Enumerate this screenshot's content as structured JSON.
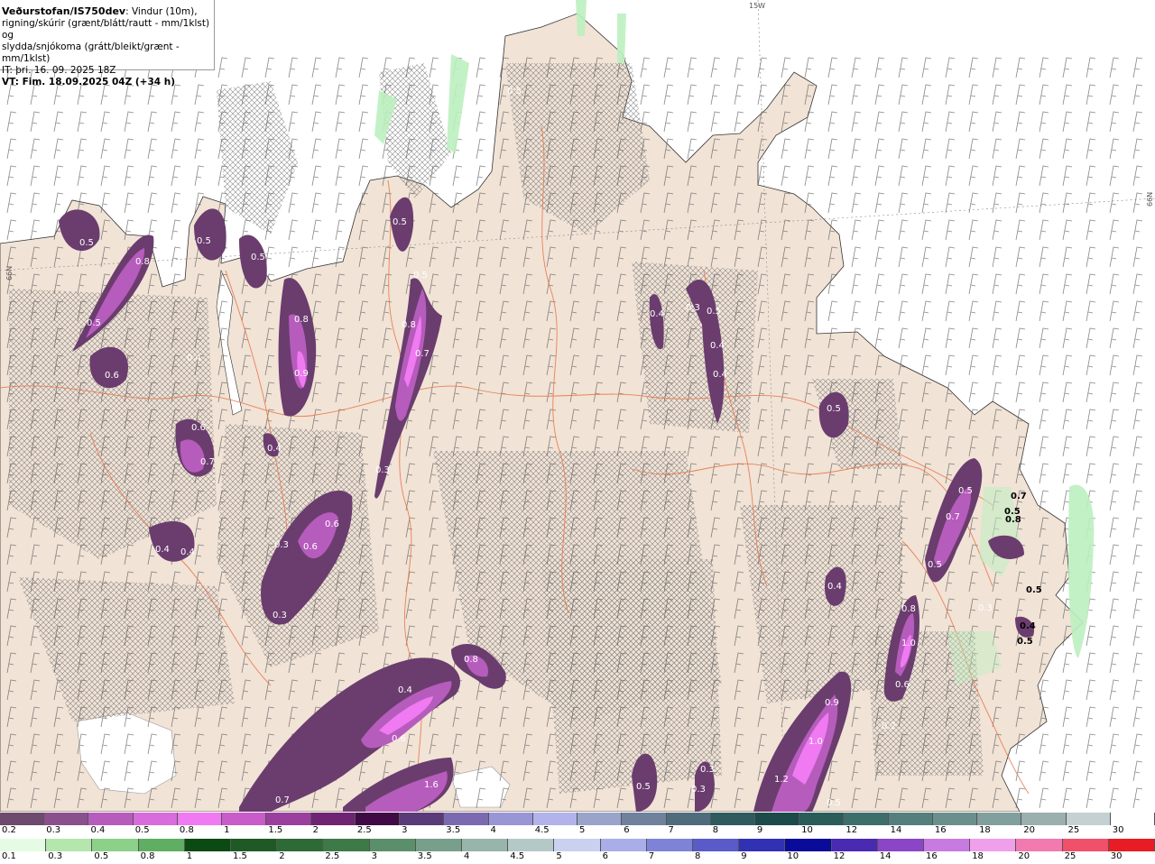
{
  "title": {
    "source": "Veðurstofan/IS750dev",
    "description_line1": ": Vindur (10m),",
    "description_line2": "rigning/skúrir (grænt/blátt/rautt - mm/1klst) og",
    "description_line3": "slydda/snjókoma (grátt/bleikt/grænt - mm/1klst)",
    "issue_time": "IT: þri. 16. 09. 2025 18Z",
    "valid_time": "VT: Fim. 18.09.2025 04Z (+34 h)"
  },
  "grid_labels": {
    "top_meridian": "15W",
    "right_parallel": "66N",
    "left_parallel": "66N"
  },
  "colors": {
    "sea": "#ffffff",
    "land": "#f1e3d6",
    "roads": "#e8774a",
    "snow_dark": "#6a3d6e",
    "snow_mid": "#a64fb2",
    "snow_light": "#e07ee6",
    "rain_green": "#bdf0c0"
  },
  "snow_legend": {
    "labels": [
      "0.2",
      "0.3",
      "0.4",
      "0.5",
      "0.8",
      "1",
      "1.5",
      "2",
      "2.5",
      "3",
      "3.5",
      "4",
      "4.5",
      "5",
      "6",
      "7",
      "8",
      "9",
      "10",
      "12",
      "14",
      "16",
      "18",
      "20",
      "25",
      "30"
    ],
    "colors": [
      "#6d4a6e",
      "#8a4f8c",
      "#b65cbc",
      "#d96cdc",
      "#f07af2",
      "#c85cc9",
      "#9b3f9e",
      "#6f2373",
      "#3f0a45",
      "#5a3a78",
      "#7b6ab0",
      "#9a96d6",
      "#b2b3ea",
      "#9aa3c9",
      "#6f819d",
      "#4f6c7c",
      "#2f5a5e",
      "#1d4a4a",
      "#2a5c5a",
      "#3e6e6c",
      "#547f7c",
      "#6a8f8c",
      "#819f9d",
      "#9aafae",
      "#c5d0d2",
      "#ffffff"
    ]
  },
  "rain_legend": {
    "labels": [
      "0.1",
      "0.3",
      "0.5",
      "0.8",
      "1",
      "1.5",
      "2",
      "2.5",
      "3",
      "3.5",
      "4",
      "4.5",
      "5",
      "6",
      "7",
      "8",
      "9",
      "10",
      "12",
      "14",
      "16",
      "18",
      "20",
      "25",
      "30"
    ],
    "colors": [
      "#e6fbe4",
      "#b4e6ae",
      "#8cd08a",
      "#5fae63",
      "#0b4a12",
      "#1f5a26",
      "#2e6a35",
      "#3d7a48",
      "#5b8f6c",
      "#789f8c",
      "#97b5ab",
      "#b4c8c8",
      "#c9d1f0",
      "#a9aee8",
      "#7f83d8",
      "#5a5ac8",
      "#3131b4",
      "#0b0b9a",
      "#4a2ab0",
      "#8a46c6",
      "#c77ae0",
      "#f0a0ea",
      "#f27ab0",
      "#f0506a",
      "#e81c24"
    ]
  },
  "map_labels": [
    {
      "text": "0.5"
    },
    {
      "text": "0.8"
    },
    {
      "text": "0.5"
    },
    {
      "text": "0.6"
    },
    {
      "text": "0.4"
    },
    {
      "text": "0.6"
    },
    {
      "text": "0.7"
    },
    {
      "text": "0.4"
    },
    {
      "text": "0.4"
    },
    {
      "text": "0.5"
    },
    {
      "text": "0.5"
    },
    {
      "text": "0.8"
    },
    {
      "text": "0.9"
    },
    {
      "text": "0.4"
    },
    {
      "text": "0.5"
    },
    {
      "text": "0.5"
    },
    {
      "text": "0.8"
    },
    {
      "text": "0.7"
    },
    {
      "text": "0.3"
    },
    {
      "text": "0.6"
    },
    {
      "text": "0.3"
    },
    {
      "text": "0.6"
    },
    {
      "text": "0.3"
    },
    {
      "text": "0.5"
    },
    {
      "text": "0.4"
    },
    {
      "text": "0.5"
    },
    {
      "text": "0.4"
    },
    {
      "text": "0.4"
    },
    {
      "text": "0.3"
    },
    {
      "text": "0.5"
    },
    {
      "text": "0.5"
    },
    {
      "text": "0.7"
    },
    {
      "text": "0.5"
    },
    {
      "text": "0.4"
    },
    {
      "text": "0.8"
    },
    {
      "text": "1.0"
    },
    {
      "text": "0.6"
    },
    {
      "text": "0.2"
    },
    {
      "text": "0.8"
    },
    {
      "text": "0.4"
    },
    {
      "text": "0.6"
    },
    {
      "text": "1.6"
    },
    {
      "text": "0.7"
    },
    {
      "text": "0.5"
    },
    {
      "text": "0.3"
    },
    {
      "text": "0.3"
    },
    {
      "text": "0.9"
    },
    {
      "text": "1.0"
    },
    {
      "text": "1.2"
    },
    {
      "text": "0.5"
    },
    {
      "text": "0.3"
    }
  ],
  "coast_labels": [
    {
      "text": "0.7"
    },
    {
      "text": "0.5"
    },
    {
      "text": "0.8"
    },
    {
      "text": "0.5"
    },
    {
      "text": "0.4"
    },
    {
      "text": "0.5"
    }
  ]
}
